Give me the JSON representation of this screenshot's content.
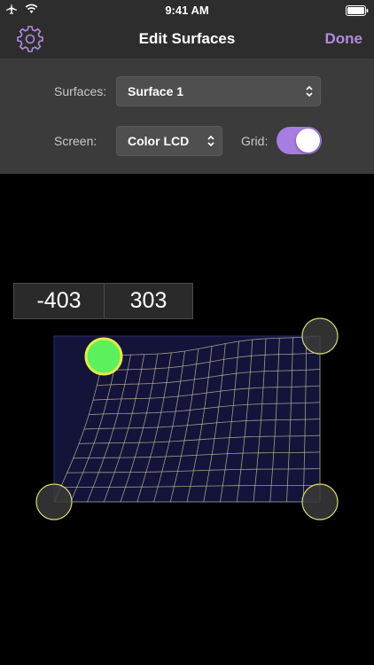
{
  "status_bar": {
    "time": "9:41 AM",
    "icons": [
      "airplane-icon",
      "wifi-icon",
      "battery-icon"
    ]
  },
  "nav": {
    "title": "Edit Surfaces",
    "done_label": "Done",
    "left_icon": "gear-icon"
  },
  "controls": {
    "surfaces_label": "Surfaces:",
    "surfaces_value": "Surface 1",
    "screen_label": "Screen:",
    "screen_value": "Color LCD",
    "grid_label": "Grid:",
    "grid_on": true
  },
  "coordinates": {
    "x": "-403",
    "y": "303"
  },
  "colors": {
    "accent": "#b08ae3",
    "toggle_on": "#a77de1",
    "active_handle": "#5cf05c",
    "handle_stroke": "#e6e68a",
    "surface_fill": "#14143a",
    "grid_line": "#c8c8a0"
  }
}
